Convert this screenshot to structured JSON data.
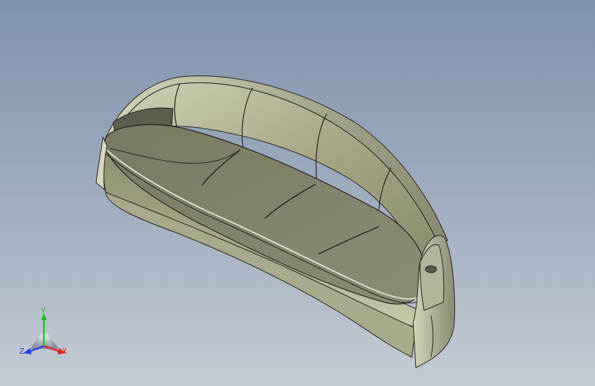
{
  "viewport": {
    "background_top": "#7f93ad",
    "background_bottom": "#c4cbd4"
  },
  "model": {
    "type": "curved-sofa",
    "body_color": "#a8a888",
    "shade_color": "#6e6e58",
    "edge_color": "#1e1e1a",
    "seat_cushions": 4,
    "back_cushions": 4
  },
  "triad": {
    "x_label": "X",
    "y_label": "Y",
    "z_label": "Z",
    "x_color": "#e02020",
    "y_color": "#20c020",
    "z_color": "#2040e0"
  }
}
